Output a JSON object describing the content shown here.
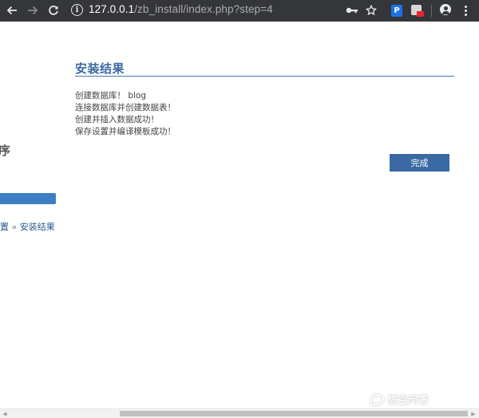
{
  "browser": {
    "url_host": "127.0.0.1",
    "url_path": "/zb_install/index.php?step=4",
    "icons": [
      "back-arrow-icon",
      "forward-arrow-icon",
      "reload-icon",
      "info-icon",
      "key-icon",
      "star-icon",
      "extension-p-icon",
      "extension-icon",
      "profile-icon",
      "menu-icon"
    ]
  },
  "sidebar": {
    "title_fragment": "序",
    "steps_prefix": "置",
    "steps_sep": "»",
    "current_step": "安装结果"
  },
  "main": {
    "title": "安装结果",
    "messages": [
      "创建数据库！ blog",
      "连接数据库并创建数据表！",
      "创建并插入数据成功！",
      "保存设置并编译模板成功！"
    ],
    "done_button": "完成"
  },
  "watermark": "悟空问答",
  "colors": {
    "toolbar_bg": "#35363a",
    "accent": "#3a6aa3",
    "sidebar_bar": "#3d7fc4"
  }
}
